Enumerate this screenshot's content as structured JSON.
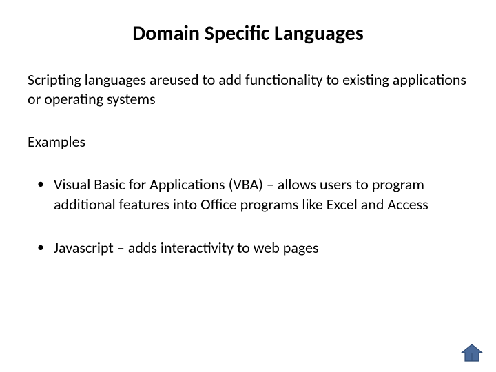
{
  "slide": {
    "title": "Domain Specific Languages",
    "intro": "Scripting languages areused to add functionality to existing applications or operating systems",
    "examples_label": "Examples",
    "bullets": [
      "Visual Basic for Applications (VBA) – allows users to program additional features into Office programs like Excel and Access",
      "Javascript – adds interactivity to web pages"
    ]
  },
  "icons": {
    "home": "home-icon"
  },
  "colors": {
    "home_fill": "#4a6a9a",
    "home_stroke": "#2f4a72"
  }
}
